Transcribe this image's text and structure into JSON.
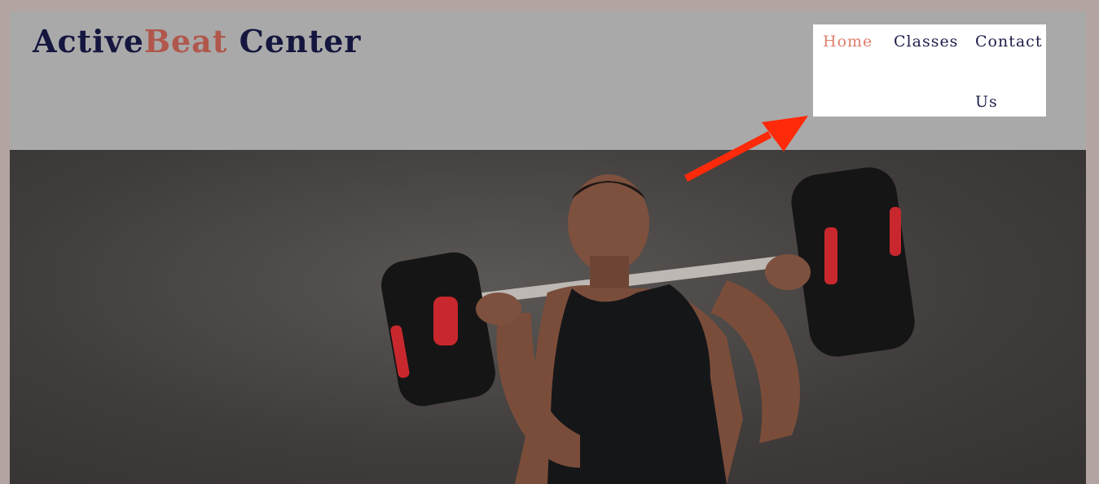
{
  "brand": {
    "part1": "Active",
    "part2": "Beat",
    "part3": " Center"
  },
  "nav": {
    "home": "Home",
    "classes": "Classes",
    "contact_line1": "Contact",
    "contact_line2": "Us"
  },
  "colors": {
    "brand_dark": "#14163f",
    "brand_accent": "#b0574c",
    "nav_active": "#e07f6f",
    "annotation_arrow": "#ff2a0a"
  },
  "hero": {
    "image": "man-lifting-barbell-photo"
  }
}
